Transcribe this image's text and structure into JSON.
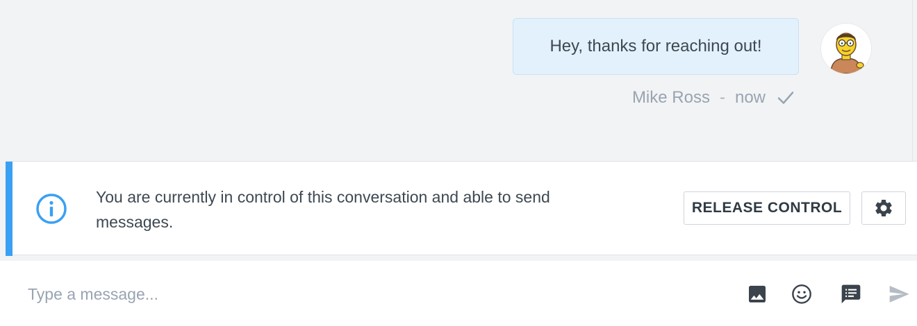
{
  "conversation": {
    "messages": [
      {
        "text": "Hey, thanks for reaching out!",
        "author": "Mike Ross",
        "separator": "-",
        "time": "now",
        "status_icon": "checkmark-icon",
        "avatar_icon": "cartoon-avatar"
      }
    ]
  },
  "control_banner": {
    "accent_color": "#3aa0f3",
    "icon": "info-icon",
    "message": "You are currently in control of this conversation and able to send messages.",
    "release_label": "RELEASE CONTROL",
    "settings_icon": "gear-icon"
  },
  "composer": {
    "placeholder": "Type a message...",
    "value": "",
    "tools": [
      "image-icon",
      "emoji-icon",
      "saved-replies-icon",
      "send-icon"
    ]
  }
}
